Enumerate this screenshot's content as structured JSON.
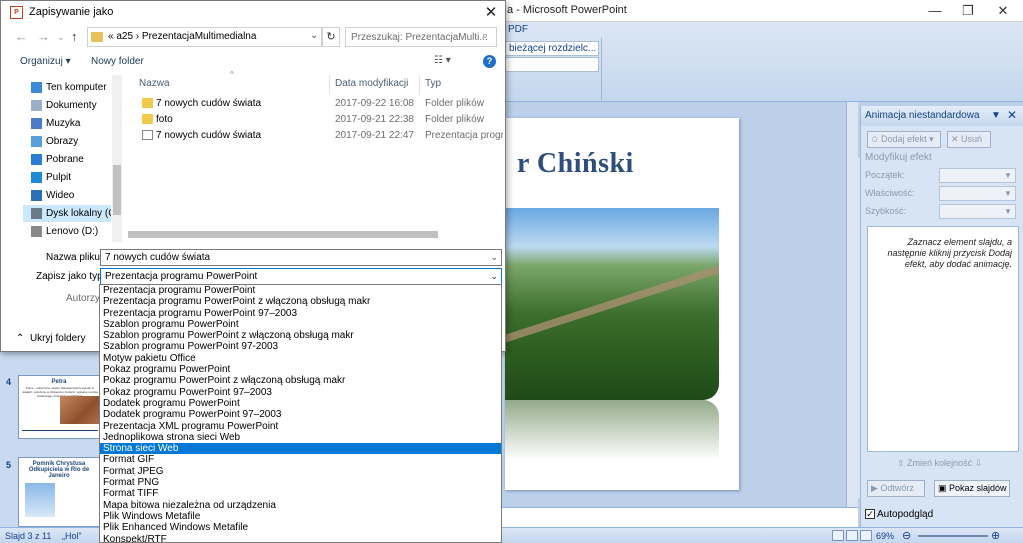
{
  "ppt": {
    "title": "a - Microsoft PowerPoint",
    "ribbon_tab": "PDF",
    "ribbon_combo": "bieżącej rozdzielc...",
    "slide_title": "r Chiński",
    "status_slide": "Slajd 3 z 11",
    "status_theme": "„Hol”",
    "zoom": "69%",
    "thumbs": [
      {
        "num": "4",
        "title": "Petra",
        "text": "Petra – starożytne miasto Nabatejczyków wykute w skałach, położone w dzisiejszej Jordanii, wpisane na listę światowego dziedzictwa UNESCO"
      },
      {
        "num": "5",
        "title": "Pomnik Chrystusa Odkupiciela w Rio de Janeiro",
        "text": ""
      }
    ]
  },
  "taskpane": {
    "title": "Animacja niestandardowa",
    "add_effect": "Dodaj efekt",
    "remove": "Usuń",
    "modify": "Modyfikuj efekt",
    "start_label": "Początek:",
    "property_label": "Właściwość:",
    "speed_label": "Szybkość:",
    "hint": "Zaznacz element slajdu, a następnie kliknij przycisk Dodaj efekt, aby dodać animację.",
    "reorder": "Zmień kolejność",
    "play": "Odtwórz",
    "slideshow": "Pokaz slajdów",
    "autopreview": "Autopodgląd"
  },
  "dialog": {
    "title": "Zapisywanie jako",
    "address": "«  a25  ›  PrezentacjaMultimedialna",
    "search_placeholder": "Przeszukaj: PrezentacjaMulti...",
    "organize": "Organizuj ▾",
    "new_folder": "Nowy folder",
    "nav_items": [
      {
        "label": "Ten komputer",
        "color": "#3a8ad6"
      },
      {
        "label": "Dokumenty",
        "color": "#9ab0c8"
      },
      {
        "label": "Muzyka",
        "color": "#4a7cc8"
      },
      {
        "label": "Obrazy",
        "color": "#5aa0d8"
      },
      {
        "label": "Pobrane",
        "color": "#2b7cd3"
      },
      {
        "label": "Pulpit",
        "color": "#1f8ad6"
      },
      {
        "label": "Wideo",
        "color": "#2a6fb8"
      },
      {
        "label": "Dysk lokalny (C:)",
        "color": "#6a7a8a"
      },
      {
        "label": "Lenovo (D:)",
        "color": "#8a8a8a"
      }
    ],
    "columns": {
      "name": "Nazwa",
      "date": "Data modyfikacji",
      "type": "Typ"
    },
    "files": [
      {
        "name": "7 nowych cudów świata",
        "date": "2017-09-22 16:08",
        "type": "Folder plików",
        "kind": "folder"
      },
      {
        "name": "foto",
        "date": "2017-09-21 22:38",
        "type": "Folder plików",
        "kind": "folder"
      },
      {
        "name": "7 nowych cudów świata",
        "date": "2017-09-21 22:47",
        "type": "Prezentacja progr...",
        "kind": "ppt"
      }
    ],
    "filename_label": "Nazwa pliku:",
    "filename": "7 nowych cudów świata",
    "type_label": "Zapisz jako typ:",
    "type_value": "Prezentacja programu PowerPoint",
    "authors_label": "Autorzy:",
    "hide_folders": "Ukryj foldery",
    "types": [
      "Prezentacja programu PowerPoint",
      "Prezentacja programu PowerPoint z włączoną obsługą makr",
      "Prezentacja programu PowerPoint 97–2003",
      "Szablon programu PowerPoint",
      "Szablon programu PowerPoint z włączoną obsługą makr",
      "Szablon programu PowerPoint 97-2003",
      "Motyw pakietu Office",
      "Pokaz programu PowerPoint",
      "Pokaz programu PowerPoint z włączoną obsługą makr",
      "Pokaz programu PowerPoint 97–2003",
      "Dodatek programu PowerPoint",
      "Dodatek programu PowerPoint 97–2003",
      "Prezentacja XML programu PowerPoint",
      "Jednoplikowa strona sieci Web",
      "Strona sieci Web",
      "Format GIF",
      "Format JPEG",
      "Format PNG",
      "Format TIFF",
      "Mapa bitowa niezależna od urządzenia",
      "Plik Windows Metafile",
      "Plik Enhanced Windows Metafile",
      "Konspekt/RTF"
    ],
    "selected_type_index": 14
  }
}
